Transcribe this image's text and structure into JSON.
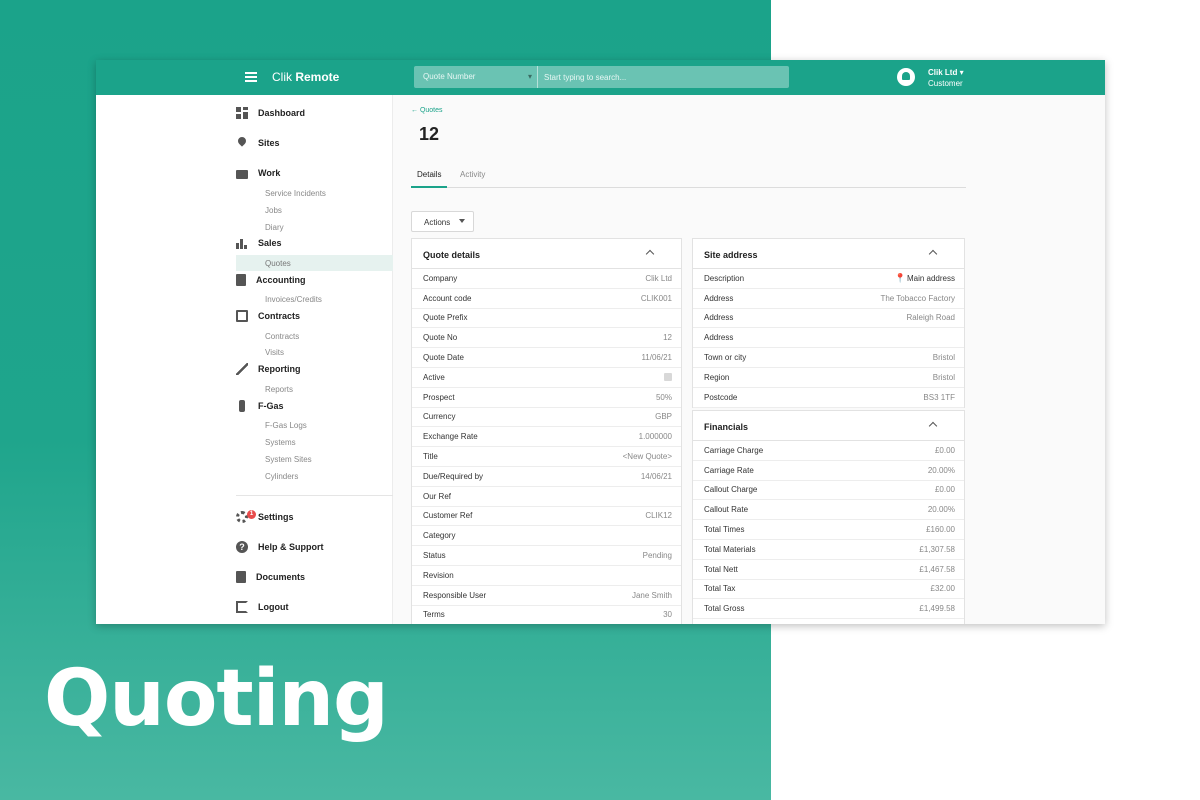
{
  "hero": {
    "title": "Quoting"
  },
  "header": {
    "brand_light": "Clik",
    "brand_bold": "Remote",
    "search_type": "Quote Number",
    "search_placeholder": "Start typing to search...",
    "user_name": "Clik Ltd",
    "user_role": "Customer"
  },
  "sidebar": {
    "dashboard": "Dashboard",
    "sites": "Sites",
    "work": "Work",
    "work_items": [
      "Service Incidents",
      "Jobs",
      "Diary"
    ],
    "sales": "Sales",
    "sales_items": [
      "Quotes"
    ],
    "accounting": "Accounting",
    "accounting_items": [
      "Invoices/Credits"
    ],
    "contracts": "Contracts",
    "contracts_items": [
      "Contracts",
      "Visits"
    ],
    "reporting": "Reporting",
    "reporting_items": [
      "Reports"
    ],
    "fgas": "F-Gas",
    "fgas_items": [
      "F-Gas Logs",
      "Systems",
      "System Sites",
      "Cylinders"
    ],
    "settings": "Settings",
    "settings_badge": "1",
    "help": "Help & Support",
    "documents": "Documents",
    "logout": "Logout"
  },
  "page": {
    "breadcrumb": "← Quotes",
    "title": "12",
    "tabs": [
      "Details",
      "Activity"
    ],
    "actions_label": "Actions"
  },
  "quote_details": {
    "title": "Quote details",
    "rows": [
      {
        "label": "Company",
        "value": "Clik Ltd"
      },
      {
        "label": "Account code",
        "value": "CLIK001"
      },
      {
        "label": "Quote Prefix",
        "value": ""
      },
      {
        "label": "Quote No",
        "value": "12"
      },
      {
        "label": "Quote Date",
        "value": "11/06/21"
      },
      {
        "label": "Active",
        "value": ""
      },
      {
        "label": "Prospect",
        "value": "50%"
      },
      {
        "label": "Currency",
        "value": "GBP"
      },
      {
        "label": "Exchange Rate",
        "value": "1.000000"
      },
      {
        "label": "Title",
        "value": "<New Quote>"
      },
      {
        "label": "Due/Required by",
        "value": "14/06/21"
      },
      {
        "label": "Our Ref",
        "value": ""
      },
      {
        "label": "Customer Ref",
        "value": "CLIK12"
      },
      {
        "label": "Category",
        "value": ""
      },
      {
        "label": "Status",
        "value": "Pending"
      },
      {
        "label": "Revision",
        "value": ""
      },
      {
        "label": "Responsible User",
        "value": "Jane Smith"
      },
      {
        "label": "Terms",
        "value": "30"
      }
    ]
  },
  "site_address": {
    "title": "Site address",
    "rows": [
      {
        "label": "Description",
        "value": "Main address"
      },
      {
        "label": "Address",
        "value": "The Tobacco Factory"
      },
      {
        "label": "Address",
        "value": "Raleigh Road"
      },
      {
        "label": "Address",
        "value": ""
      },
      {
        "label": "Town or city",
        "value": "Bristol"
      },
      {
        "label": "Region",
        "value": "Bristol"
      },
      {
        "label": "Postcode",
        "value": "BS3 1TF"
      }
    ]
  },
  "financials": {
    "title": "Financials",
    "rows": [
      {
        "label": "Carriage Charge",
        "value": "£0.00"
      },
      {
        "label": "Carriage Rate",
        "value": "20.00%"
      },
      {
        "label": "Callout Charge",
        "value": "£0.00"
      },
      {
        "label": "Callout Rate",
        "value": "20.00%"
      },
      {
        "label": "Total Times",
        "value": "£160.00"
      },
      {
        "label": "Total Materials",
        "value": "£1,307.58"
      },
      {
        "label": "Total Nett",
        "value": "£1,467.58"
      },
      {
        "label": "Total Tax",
        "value": "£32.00"
      },
      {
        "label": "Total Gross",
        "value": "£1,499.58"
      }
    ]
  },
  "colors": {
    "brand": "#1ba38a",
    "active_nav_bg": "#e6f2ef",
    "badge": "#e84c4c"
  }
}
